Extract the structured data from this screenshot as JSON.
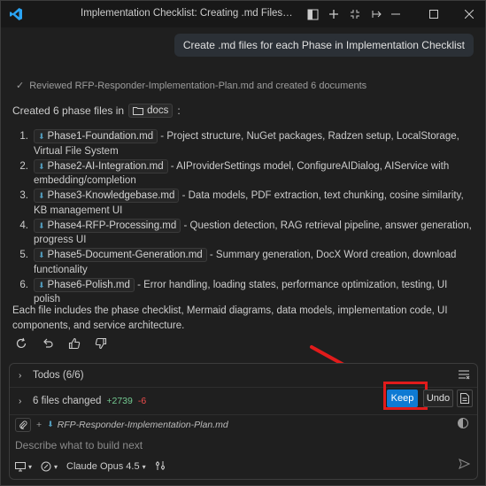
{
  "window": {
    "title": "Implementation Checklist: Creating .md Files for Ph..."
  },
  "chat": {
    "user_message": "Create .md files for each Phase in Implementation Checklist",
    "status": "Reviewed RFP-Responder-Implementation-Plan.md and created 6 documents",
    "created_prefix": "Created 6 phase files in",
    "created_folder": "docs",
    "created_suffix": ":",
    "phases": [
      {
        "num": "1.",
        "file": "Phase1-Foundation.md",
        "desc": " - Project structure, NuGet packages, Radzen setup, LocalStorage, Virtual File System"
      },
      {
        "num": "2.",
        "file": "Phase2-AI-Integration.md",
        "desc": " - AIProviderSettings model, ConfigureAIDialog, AIService with embedding/completion"
      },
      {
        "num": "3.",
        "file": "Phase3-Knowledgebase.md",
        "desc": " - Data models, PDF extraction, text chunking, cosine similarity, KB management UI"
      },
      {
        "num": "4.",
        "file": "Phase4-RFP-Processing.md",
        "desc": " - Question detection, RAG retrieval pipeline, answer generation, progress UI"
      },
      {
        "num": "5.",
        "file": "Phase5-Document-Generation.md",
        "desc": " - Summary generation, DocX Word creation, download functionality"
      },
      {
        "num": "6.",
        "file": "Phase6-Polish.md",
        "desc": " - Error handling, loading states, performance optimization, testing, UI polish"
      }
    ],
    "summary": "Each file includes the phase checklist, Mermaid diagrams, data models, implementation code, UI components, and service architecture."
  },
  "panel": {
    "todos_label": "Todos (6/6)",
    "files_label": "6 files changed",
    "added": "+2739",
    "removed": "-6",
    "keep_label": "Keep",
    "undo_label": "Undo",
    "attachment": "RFP-Responder-Implementation-Plan.md",
    "placeholder": "Describe what to build next",
    "model": "Claude Opus 4.5"
  },
  "colors": {
    "accent": "#0e7ad3",
    "highlight": "#e11b1b",
    "added": "#73c991",
    "removed": "#f14c4c"
  }
}
